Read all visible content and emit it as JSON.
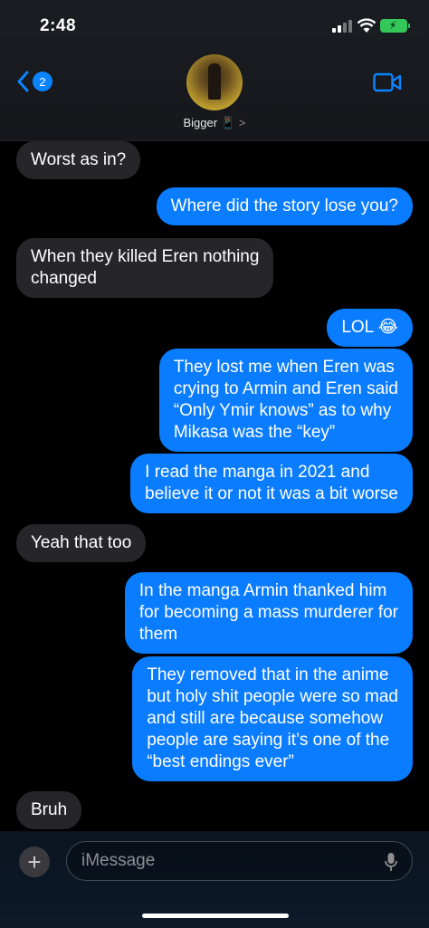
{
  "status_bar": {
    "time": "2:48"
  },
  "nav": {
    "back_badge": "2",
    "contact_name": "Bigger 📱",
    "contact_chevron": ">"
  },
  "messages": [
    {
      "dir": "in",
      "lines": [
        "Worst as in?"
      ]
    },
    {
      "dir": "out",
      "lines": [
        "Where did the story lose you?"
      ]
    },
    {
      "dir": "in",
      "lines": [
        "When they killed Eren nothing",
        "changed"
      ]
    },
    {
      "dir": "out",
      "lines": [
        "LOL 😂"
      ]
    },
    {
      "dir": "out",
      "lines": [
        "They lost me when Eren was",
        "crying to Armin and Eren said",
        "“Only Ymir knows” as to why",
        "Mikasa was the “key”"
      ]
    },
    {
      "dir": "out",
      "lines": [
        "I read the manga in 2021 and",
        "believe it or not it was a bit worse"
      ]
    },
    {
      "dir": "in",
      "lines": [
        "Yeah that too"
      ]
    },
    {
      "dir": "out",
      "lines": [
        "In the manga Armin thanked him",
        "for becoming a mass murderer for",
        "them"
      ]
    },
    {
      "dir": "out",
      "lines": [
        "They removed that in the anime",
        "but holy shit people were so mad",
        "and still are because somehow",
        "people are saying it’s one of the",
        "“best endings ever”"
      ]
    },
    {
      "dir": "in",
      "lines": [
        "Bruh"
      ]
    }
  ],
  "input": {
    "placeholder": "iMessage",
    "plus_label": "+"
  },
  "colors": {
    "outgoing": "#0a7cff",
    "incoming": "#26252a",
    "accent": "#0a84ff"
  }
}
